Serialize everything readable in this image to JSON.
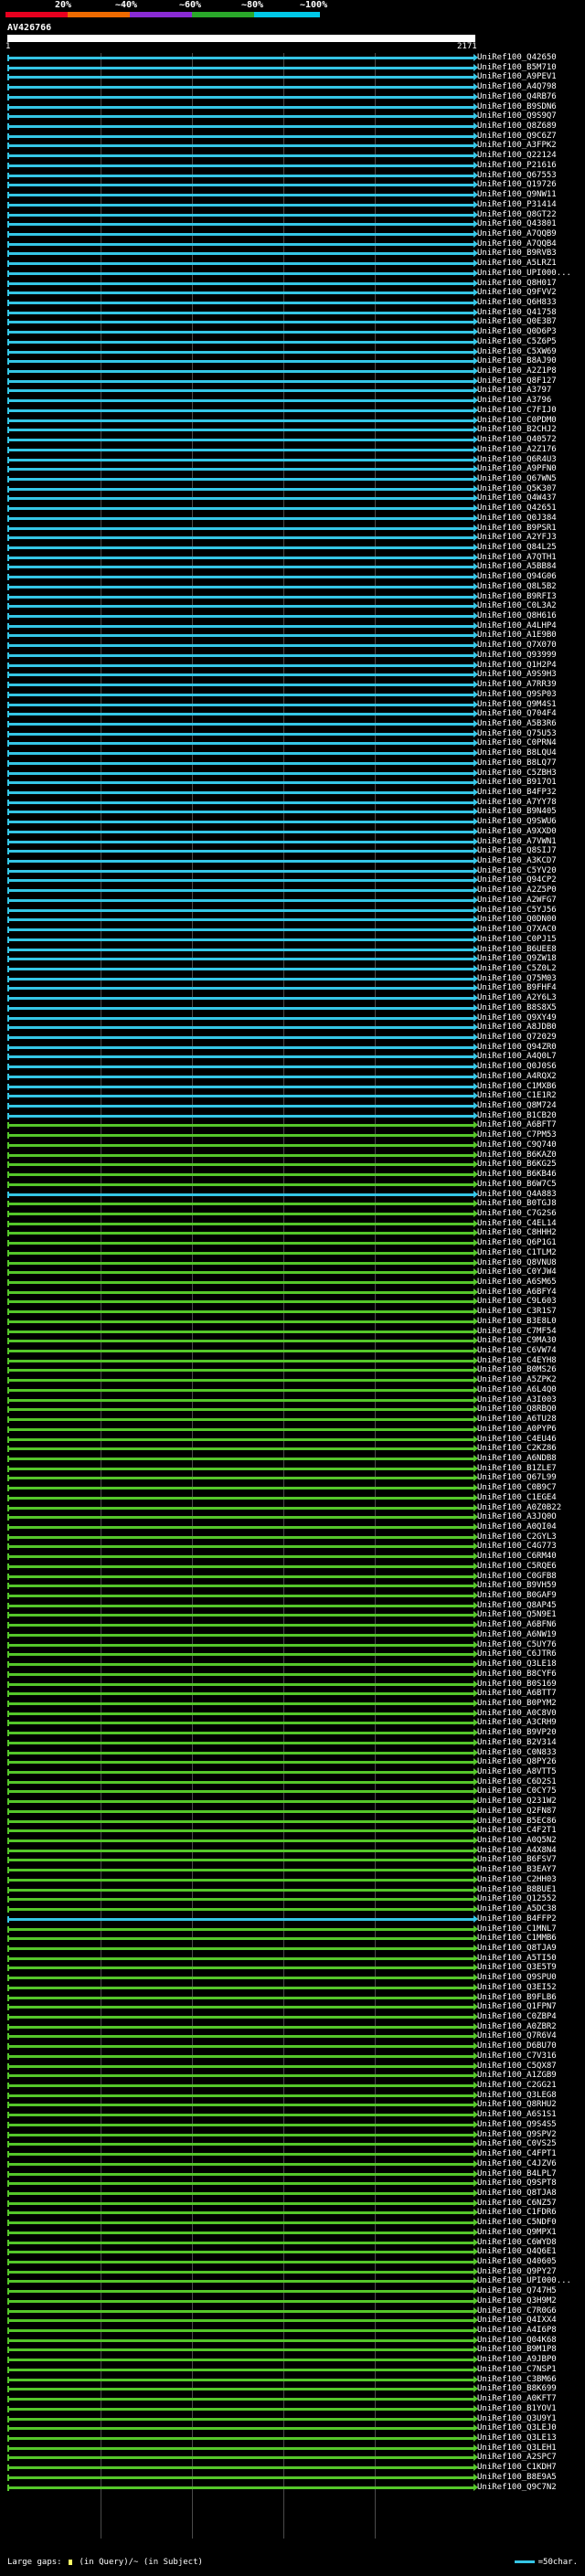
{
  "scale": {
    "labels": [
      "20%",
      "~40%",
      "~60%",
      "~80%",
      "~100%"
    ],
    "colors": [
      "#e8001f",
      "#ee6a00",
      "#8a2bd4",
      "#2aa82a",
      "#00c8e8"
    ]
  },
  "query": {
    "title": "AV426766",
    "start": "1",
    "end": "2171"
  },
  "colors": {
    "cyan": "#35c6e6",
    "green": "#55c62a"
  },
  "rows": [
    {
      "acc": "UniRef100_Q42650",
      "color": "cyan"
    },
    {
      "acc": "UniRef100_B5M710",
      "color": "cyan"
    },
    {
      "acc": "UniRef100_A9PEV1",
      "color": "cyan"
    },
    {
      "acc": "UniRef100_A4Q798",
      "color": "cyan"
    },
    {
      "acc": "UniRef100_Q4RB76",
      "color": "cyan"
    },
    {
      "acc": "UniRef100_B9SDN6",
      "color": "cyan"
    },
    {
      "acc": "UniRef100_Q9S9Q7",
      "color": "cyan"
    },
    {
      "acc": "UniRef100_Q8Z689",
      "color": "cyan"
    },
    {
      "acc": "UniRef100_Q9C6Z7",
      "color": "cyan"
    },
    {
      "acc": "UniRef100_A3FPK2",
      "color": "cyan"
    },
    {
      "acc": "UniRef100_Q22124",
      "color": "cyan"
    },
    {
      "acc": "UniRef100_P21616",
      "color": "cyan"
    },
    {
      "acc": "UniRef100_Q67553",
      "color": "cyan"
    },
    {
      "acc": "UniRef100_Q19726",
      "color": "cyan"
    },
    {
      "acc": "UniRef100_Q9NW11",
      "color": "cyan"
    },
    {
      "acc": "UniRef100_P31414",
      "color": "cyan"
    },
    {
      "acc": "UniRef100_Q8GT22",
      "color": "cyan"
    },
    {
      "acc": "UniRef100_Q43801",
      "color": "cyan"
    },
    {
      "acc": "UniRef100_A7QQB9",
      "color": "cyan"
    },
    {
      "acc": "UniRef100_A7QQB4",
      "color": "cyan"
    },
    {
      "acc": "UniRef100_B9RVB3",
      "color": "cyan"
    },
    {
      "acc": "UniRef100_A5LRZ1",
      "color": "cyan"
    },
    {
      "acc": "UniRef100_UPI000...",
      "color": "cyan"
    },
    {
      "acc": "UniRef100_Q8H017",
      "color": "cyan"
    },
    {
      "acc": "UniRef100_Q9FVV2",
      "color": "cyan"
    },
    {
      "acc": "UniRef100_Q6H833",
      "color": "cyan"
    },
    {
      "acc": "UniRef100_Q41758",
      "color": "cyan"
    },
    {
      "acc": "UniRef100_Q0E3B7",
      "color": "cyan"
    },
    {
      "acc": "UniRef100_Q0D6P3",
      "color": "cyan"
    },
    {
      "acc": "UniRef100_C5Z6P5",
      "color": "cyan"
    },
    {
      "acc": "UniRef100_C5XW69",
      "color": "cyan"
    },
    {
      "acc": "UniRef100_B8AJ90",
      "color": "cyan"
    },
    {
      "acc": "UniRef100_A2Z1P8",
      "color": "cyan"
    },
    {
      "acc": "UniRef100_Q8F127",
      "color": "cyan"
    },
    {
      "acc": "UniRef100_A3797",
      "color": "cyan"
    },
    {
      "acc": "UniRef100_A3796",
      "color": "cyan"
    },
    {
      "acc": "UniRef100_C7FIJ0",
      "color": "cyan"
    },
    {
      "acc": "UniRef100_C0PDM0",
      "color": "cyan"
    },
    {
      "acc": "UniRef100_B2CHJ2",
      "color": "cyan"
    },
    {
      "acc": "UniRef100_Q40572",
      "color": "cyan"
    },
    {
      "acc": "UniRef100_A2Z176",
      "color": "cyan"
    },
    {
      "acc": "UniRef100_Q6R4U3",
      "color": "cyan"
    },
    {
      "acc": "UniRef100_A9PFN0",
      "color": "cyan"
    },
    {
      "acc": "UniRef100_Q67WN5",
      "color": "cyan"
    },
    {
      "acc": "UniRef100_Q5K307",
      "color": "cyan"
    },
    {
      "acc": "UniRef100_Q4W437",
      "color": "cyan"
    },
    {
      "acc": "UniRef100_Q42651",
      "color": "cyan"
    },
    {
      "acc": "UniRef100_Q0J384",
      "color": "cyan"
    },
    {
      "acc": "UniRef100_B9PSR1",
      "color": "cyan"
    },
    {
      "acc": "UniRef100_A2YFJ3",
      "color": "cyan"
    },
    {
      "acc": "UniRef100_Q84L25",
      "color": "cyan"
    },
    {
      "acc": "UniRef100_A7QTH1",
      "color": "cyan"
    },
    {
      "acc": "UniRef100_A5BB84",
      "color": "cyan"
    },
    {
      "acc": "UniRef100_Q94G06",
      "color": "cyan"
    },
    {
      "acc": "UniRef100_Q8L5B2",
      "color": "cyan"
    },
    {
      "acc": "UniRef100_B9RFI3",
      "color": "cyan"
    },
    {
      "acc": "UniRef100_C0L3A2",
      "color": "cyan"
    },
    {
      "acc": "UniRef100_Q8H616",
      "color": "cyan"
    },
    {
      "acc": "UniRef100_A4LHP4",
      "color": "cyan"
    },
    {
      "acc": "UniRef100_A1E9B0",
      "color": "cyan"
    },
    {
      "acc": "UniRef100_Q7X070",
      "color": "cyan"
    },
    {
      "acc": "UniRef100_Q93999",
      "color": "cyan"
    },
    {
      "acc": "UniRef100_Q1H2P4",
      "color": "cyan"
    },
    {
      "acc": "UniRef100_A9S9H3",
      "color": "cyan"
    },
    {
      "acc": "UniRef100_A7RR39",
      "color": "cyan"
    },
    {
      "acc": "UniRef100_Q9SP03",
      "color": "cyan"
    },
    {
      "acc": "UniRef100_Q9M4S1",
      "color": "cyan"
    },
    {
      "acc": "UniRef100_Q704F4",
      "color": "cyan"
    },
    {
      "acc": "UniRef100_A5B3R6",
      "color": "cyan"
    },
    {
      "acc": "UniRef100_Q75U53",
      "color": "cyan"
    },
    {
      "acc": "UniRef100_C0PRN4",
      "color": "cyan"
    },
    {
      "acc": "UniRef100_B8LQU4",
      "color": "cyan"
    },
    {
      "acc": "UniRef100_B8LQ77",
      "color": "cyan"
    },
    {
      "acc": "UniRef100_C5ZBH3",
      "color": "cyan"
    },
    {
      "acc": "UniRef100_B917O1",
      "color": "cyan"
    },
    {
      "acc": "UniRef100_B4FP32",
      "color": "cyan"
    },
    {
      "acc": "UniRef100_A7YY78",
      "color": "cyan"
    },
    {
      "acc": "UniRef100_B9N405",
      "color": "cyan"
    },
    {
      "acc": "UniRef100_Q9SWU6",
      "color": "cyan"
    },
    {
      "acc": "UniRef100_A9XXD0",
      "color": "cyan"
    },
    {
      "acc": "UniRef100_A7VWN1",
      "color": "cyan"
    },
    {
      "acc": "UniRef100_Q8SIJ7",
      "color": "cyan"
    },
    {
      "acc": "UniRef100_A3KCD7",
      "color": "cyan"
    },
    {
      "acc": "UniRef100_C5YV20",
      "color": "cyan"
    },
    {
      "acc": "UniRef100_Q94CP2",
      "color": "cyan"
    },
    {
      "acc": "UniRef100_A2Z5P0",
      "color": "cyan"
    },
    {
      "acc": "UniRef100_A2WFG7",
      "color": "cyan"
    },
    {
      "acc": "UniRef100_C5YJ56",
      "color": "cyan"
    },
    {
      "acc": "UniRef100_Q0DN00",
      "color": "cyan"
    },
    {
      "acc": "UniRef100_Q7XAC0",
      "color": "cyan"
    },
    {
      "acc": "UniRef100_C0PJ15",
      "color": "cyan"
    },
    {
      "acc": "UniRef100_B6UEE8",
      "color": "cyan"
    },
    {
      "acc": "UniRef100_Q9ZW18",
      "color": "cyan"
    },
    {
      "acc": "UniRef100_C5Z0L2",
      "color": "cyan"
    },
    {
      "acc": "UniRef100_Q75M03",
      "color": "cyan"
    },
    {
      "acc": "UniRef100_B9FHF4",
      "color": "cyan"
    },
    {
      "acc": "UniRef100_A2Y6L3",
      "color": "cyan"
    },
    {
      "acc": "UniRef100_B8S8X5",
      "color": "cyan"
    },
    {
      "acc": "UniRef100_Q9XY49",
      "color": "cyan"
    },
    {
      "acc": "UniRef100_A8JDB0",
      "color": "cyan"
    },
    {
      "acc": "UniRef100_Q72029",
      "color": "cyan"
    },
    {
      "acc": "UniRef100_Q94ZR0",
      "color": "cyan"
    },
    {
      "acc": "UniRef100_A4Q0L7",
      "color": "cyan"
    },
    {
      "acc": "UniRef100_Q0J0S6",
      "color": "cyan"
    },
    {
      "acc": "UniRef100_A4RQX2",
      "color": "cyan"
    },
    {
      "acc": "UniRef100_C1MXB6",
      "color": "cyan"
    },
    {
      "acc": "UniRef100_C1E1R2",
      "color": "cyan"
    },
    {
      "acc": "UniRef100_Q8M724",
      "color": "cyan"
    },
    {
      "acc": "UniRef100_B1CB20",
      "color": "cyan"
    },
    {
      "acc": "UniRef100_A6BFT7",
      "color": "green"
    },
    {
      "acc": "UniRef100_C7PM53",
      "color": "green"
    },
    {
      "acc": "UniRef100_C9Q740",
      "color": "green"
    },
    {
      "acc": "UniRef100_B6KAZ0",
      "color": "green"
    },
    {
      "acc": "UniRef100_B6KG25",
      "color": "green"
    },
    {
      "acc": "UniRef100_B6KB46",
      "color": "green"
    },
    {
      "acc": "UniRef100_B6W7C5",
      "color": "green"
    },
    {
      "acc": "UniRef100_Q4A883",
      "color": "cyan"
    },
    {
      "acc": "UniRef100_B0TGJ8",
      "color": "green"
    },
    {
      "acc": "UniRef100_C7G2S6",
      "color": "green"
    },
    {
      "acc": "UniRef100_C4EL14",
      "color": "green"
    },
    {
      "acc": "UniRef100_C8HHH2",
      "color": "green"
    },
    {
      "acc": "UniRef100_Q6P1G1",
      "color": "green"
    },
    {
      "acc": "UniRef100_C1TLM2",
      "color": "green"
    },
    {
      "acc": "UniRef100_Q8VNU8",
      "color": "green"
    },
    {
      "acc": "UniRef100_C0YJW4",
      "color": "green"
    },
    {
      "acc": "UniRef100_A6SM65",
      "color": "green"
    },
    {
      "acc": "UniRef100_A6BFY4",
      "color": "green"
    },
    {
      "acc": "UniRef100_C9L603",
      "color": "green"
    },
    {
      "acc": "UniRef100_C3R1S7",
      "color": "green"
    },
    {
      "acc": "UniRef100_B3E8L0",
      "color": "green"
    },
    {
      "acc": "UniRef100_C7MF54",
      "color": "green"
    },
    {
      "acc": "UniRef100_C9MA30",
      "color": "green"
    },
    {
      "acc": "UniRef100_C6VW74",
      "color": "green"
    },
    {
      "acc": "UniRef100_C4EYH8",
      "color": "green"
    },
    {
      "acc": "UniRef100_B0MS26",
      "color": "green"
    },
    {
      "acc": "UniRef100_A5ZPK2",
      "color": "green"
    },
    {
      "acc": "UniRef100_A6L4Q0",
      "color": "green"
    },
    {
      "acc": "UniRef100_A3I003",
      "color": "green"
    },
    {
      "acc": "UniRef100_Q8RBQ0",
      "color": "green"
    },
    {
      "acc": "UniRef100_A6TU28",
      "color": "green"
    },
    {
      "acc": "UniRef100_A0PYP6",
      "color": "green"
    },
    {
      "acc": "UniRef100_C4EU46",
      "color": "green"
    },
    {
      "acc": "UniRef100_C2KZ86",
      "color": "green"
    },
    {
      "acc": "UniRef100_A6NDB8",
      "color": "green"
    },
    {
      "acc": "UniRef100_B1ZLE7",
      "color": "green"
    },
    {
      "acc": "UniRef100_Q67L99",
      "color": "green"
    },
    {
      "acc": "UniRef100_C0B9C7",
      "color": "green"
    },
    {
      "acc": "UniRef100_C1EGE4",
      "color": "green"
    },
    {
      "acc": "UniRef100_A0Z0B22",
      "color": "green"
    },
    {
      "acc": "UniRef100_A3JQ0O",
      "color": "green"
    },
    {
      "acc": "UniRef100_A0QI04",
      "color": "green"
    },
    {
      "acc": "UniRef100_C2GYL3",
      "color": "green"
    },
    {
      "acc": "UniRef100_C4G773",
      "color": "green"
    },
    {
      "acc": "UniRef100_C6RM40",
      "color": "green"
    },
    {
      "acc": "UniRef100_C5RQE6",
      "color": "green"
    },
    {
      "acc": "UniRef100_C0GFB8",
      "color": "green"
    },
    {
      "acc": "UniRef100_B9VH59",
      "color": "green"
    },
    {
      "acc": "UniRef100_B0GAF9",
      "color": "green"
    },
    {
      "acc": "UniRef100_Q8AP45",
      "color": "green"
    },
    {
      "acc": "UniRef100_Q5N9E1",
      "color": "green"
    },
    {
      "acc": "UniRef100_A6BFN6",
      "color": "green"
    },
    {
      "acc": "UniRef100_A6NW19",
      "color": "green"
    },
    {
      "acc": "UniRef100_C5UY76",
      "color": "green"
    },
    {
      "acc": "UniRef100_C6JTR6",
      "color": "green"
    },
    {
      "acc": "UniRef100_Q3LE18",
      "color": "green"
    },
    {
      "acc": "UniRef100_B8CYF6",
      "color": "green"
    },
    {
      "acc": "UniRef100_B0S169",
      "color": "green"
    },
    {
      "acc": "UniRef100_A6BTT7",
      "color": "green"
    },
    {
      "acc": "UniRef100_B0PYM2",
      "color": "green"
    },
    {
      "acc": "UniRef100_A0C8V0",
      "color": "green"
    },
    {
      "acc": "UniRef100_A3CRH9",
      "color": "green"
    },
    {
      "acc": "UniRef100_B9VP20",
      "color": "green"
    },
    {
      "acc": "UniRef100_B2V314",
      "color": "green"
    },
    {
      "acc": "UniRef100_C0N833",
      "color": "green"
    },
    {
      "acc": "UniRef100_Q8PY26",
      "color": "green"
    },
    {
      "acc": "UniRef100_A8VTT5",
      "color": "green"
    },
    {
      "acc": "UniRef100_C6D2S1",
      "color": "green"
    },
    {
      "acc": "UniRef100_C0CY75",
      "color": "green"
    },
    {
      "acc": "UniRef100_Q231W2",
      "color": "green"
    },
    {
      "acc": "UniRef100_Q2FN87",
      "color": "green"
    },
    {
      "acc": "UniRef100_B5EC86",
      "color": "green"
    },
    {
      "acc": "UniRef100_C4F2T1",
      "color": "green"
    },
    {
      "acc": "UniRef100_A0Q5N2",
      "color": "green"
    },
    {
      "acc": "UniRef100_A4X8N4",
      "color": "green"
    },
    {
      "acc": "UniRef100_B6FSV7",
      "color": "green"
    },
    {
      "acc": "UniRef100_B3EAY7",
      "color": "green"
    },
    {
      "acc": "UniRef100_C2HH03",
      "color": "green"
    },
    {
      "acc": "UniRef100_B8BUE1",
      "color": "green"
    },
    {
      "acc": "UniRef100_Q12552",
      "color": "green"
    },
    {
      "acc": "UniRef100_A5DC38",
      "color": "green"
    },
    {
      "acc": "UniRef100_B4FFP2",
      "color": "cyan"
    },
    {
      "acc": "UniRef100_C1MNL7",
      "color": "green"
    },
    {
      "acc": "UniRef100_C1MMB6",
      "color": "green"
    },
    {
      "acc": "UniRef100_Q8TJA9",
      "color": "green"
    },
    {
      "acc": "UniRef100_A5TI50",
      "color": "green"
    },
    {
      "acc": "UniRef100_Q3E5T9",
      "color": "green"
    },
    {
      "acc": "UniRef100_Q9SPU0",
      "color": "green"
    },
    {
      "acc": "UniRef100_Q3EI52",
      "color": "green"
    },
    {
      "acc": "UniRef100_B9FLB6",
      "color": "green"
    },
    {
      "acc": "UniRef100_Q1FPN7",
      "color": "green"
    },
    {
      "acc": "UniRef100_C0ZBP4",
      "color": "green"
    },
    {
      "acc": "UniRef100_A0ZBR2",
      "color": "green"
    },
    {
      "acc": "UniRef100_Q7R6V4",
      "color": "green"
    },
    {
      "acc": "UniRef100_D6BU70",
      "color": "green"
    },
    {
      "acc": "UniRef100_C7V316",
      "color": "green"
    },
    {
      "acc": "UniRef100_C5QX87",
      "color": "green"
    },
    {
      "acc": "UniRef100_A1ZGB9",
      "color": "green"
    },
    {
      "acc": "UniRef100_C2GG21",
      "color": "green"
    },
    {
      "acc": "UniRef100_Q3LEG8",
      "color": "green"
    },
    {
      "acc": "UniRef100_Q8RHU2",
      "color": "green"
    },
    {
      "acc": "UniRef100_A6S1S1",
      "color": "green"
    },
    {
      "acc": "UniRef100_Q9S4S5",
      "color": "green"
    },
    {
      "acc": "UniRef100_Q9SPV2",
      "color": "green"
    },
    {
      "acc": "UniRef100_C0VS25",
      "color": "green"
    },
    {
      "acc": "UniRef100_C4FPT1",
      "color": "green"
    },
    {
      "acc": "UniRef100_C4JZV6",
      "color": "green"
    },
    {
      "acc": "UniRef100_B4LPL7",
      "color": "green"
    },
    {
      "acc": "UniRef100_Q9SPT8",
      "color": "green"
    },
    {
      "acc": "UniRef100_Q8TJA8",
      "color": "green"
    },
    {
      "acc": "UniRef100_C6NZ57",
      "color": "green"
    },
    {
      "acc": "UniRef100_C1FDR6",
      "color": "green"
    },
    {
      "acc": "UniRef100_C5NDF0",
      "color": "green"
    },
    {
      "acc": "UniRef100_Q9MPX1",
      "color": "green"
    },
    {
      "acc": "UniRef100_C6WYD8",
      "color": "green"
    },
    {
      "acc": "UniRef100_Q4Q6E1",
      "color": "green"
    },
    {
      "acc": "UniRef100_Q40605",
      "color": "green"
    },
    {
      "acc": "UniRef100_Q9PY27",
      "color": "green"
    },
    {
      "acc": "UniRef100_UPI000...",
      "color": "green"
    },
    {
      "acc": "UniRef100_Q747H5",
      "color": "green"
    },
    {
      "acc": "UniRef100_Q3H9M2",
      "color": "green"
    },
    {
      "acc": "UniRef100_C7R0G6",
      "color": "green"
    },
    {
      "acc": "UniRef100_Q4IXX4",
      "color": "green"
    },
    {
      "acc": "UniRef100_A4I6P8",
      "color": "green"
    },
    {
      "acc": "UniRef100_Q04K68",
      "color": "green"
    },
    {
      "acc": "UniRef100_B9M1P8",
      "color": "green"
    },
    {
      "acc": "UniRef100_A9JBP0",
      "color": "green"
    },
    {
      "acc": "UniRef100_C7NSP1",
      "color": "green"
    },
    {
      "acc": "UniRef100_C3BM66",
      "color": "green"
    },
    {
      "acc": "UniRef100_B8K699",
      "color": "green"
    },
    {
      "acc": "UniRef100_A0KFT7",
      "color": "green"
    },
    {
      "acc": "UniRef100_B1YOV1",
      "color": "green"
    },
    {
      "acc": "UniRef100_Q3U9Y1",
      "color": "green"
    },
    {
      "acc": "UniRef100_Q3LEJ0",
      "color": "green"
    },
    {
      "acc": "UniRef100_Q3LE13",
      "color": "green"
    },
    {
      "acc": "UniRef100_Q3LEH1",
      "color": "green"
    },
    {
      "acc": "UniRef100_A2SPC7",
      "color": "green"
    },
    {
      "acc": "UniRef100_C1KDH7",
      "color": "green"
    },
    {
      "acc": "UniRef100_B8E9A5",
      "color": "green"
    },
    {
      "acc": "UniRef100_Q9C7N2",
      "color": "green"
    }
  ],
  "legend": {
    "gaps_prefix": "Large gaps:",
    "gaps_query": "(in Query)/~ (in Subject)",
    "scale_note": "=50char."
  }
}
